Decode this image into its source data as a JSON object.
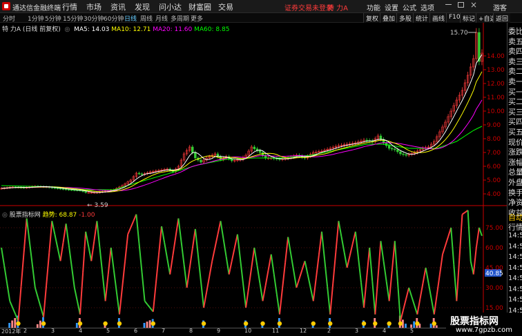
{
  "window": {
    "app_title": "通达信金融终端",
    "menu": [
      "行情",
      "市场",
      "资讯",
      "发现",
      "问小达",
      "财富圈",
      "交易"
    ],
    "login_notice": "证券交易未登录",
    "stock_name": "特 力A",
    "right_menu": [
      "功能",
      "设置",
      "公式",
      "选项"
    ],
    "guest": "游客"
  },
  "toolbar": {
    "periods": [
      "分时",
      "1分钟",
      "5分钟",
      "15分钟",
      "30分钟",
      "60分钟",
      "日线",
      "周线",
      "月线",
      "多周期",
      "更多"
    ],
    "active_period": "日线",
    "right_tools": [
      "复权",
      "叠加",
      "多股",
      "统计",
      "画线",
      "F10",
      "标记",
      "+自选",
      "返回"
    ]
  },
  "price_header": {
    "title": "特 力A (日线 前复权)",
    "ma5": "MA5: 14.03",
    "ma10": "MA10: 12.71",
    "ma20": "MA20: 11.60",
    "ma60": "MA60: 8.85"
  },
  "indicator_header": {
    "name": "股票指标网",
    "label": "趋势: ",
    "value": "68.87",
    "change": "-1.00"
  },
  "right_panel": {
    "quote_labels": [
      "委比",
      "卖五",
      "卖四",
      "卖三",
      "卖二",
      "卖一",
      "买一",
      "买二",
      "买三",
      "买四",
      "买五",
      "现价",
      "涨跌",
      "涨幅",
      "总量",
      "外盘",
      "换手",
      "净资",
      "收益"
    ],
    "auto_label": "自动",
    "quote_label": "行情",
    "times": [
      "14:5",
      "14:5",
      "14:5",
      "14:5",
      "14:5",
      "14:5",
      "14:5",
      "14:5"
    ]
  },
  "bottom_axis": {
    "year": "2012年",
    "months": [
      "2",
      "3",
      "4",
      "5",
      "6",
      "7",
      "8",
      "9",
      "10",
      "11",
      "12",
      "2",
      "3",
      "4",
      "5"
    ]
  },
  "watermark": {
    "title": "股票指标网",
    "url": "www.7gpzb.com"
  },
  "colors": {
    "up": "#ff3b3b",
    "down": "#33cc33",
    "ma5": "#ffffff",
    "ma10": "#ffff00",
    "ma20": "#ff00ff",
    "ma60": "#00ff00",
    "axis": "#cc0000"
  },
  "chart_data": [
    {
      "type": "candlestick",
      "title": "特 力A (日线 前复权)",
      "y_ticks": [
        "14.00",
        "13.00",
        "12.00",
        "11.00",
        "10.00",
        "9.00",
        "8.00",
        "7.00",
        "6.00",
        "5.00",
        "4.00"
      ],
      "y_range": [
        3.3,
        15.9
      ],
      "annotations": [
        {
          "label": "15.70",
          "value": 15.7
        },
        {
          "label": "3.59",
          "value": 3.59
        }
      ],
      "close_path": [
        [
          0,
          4.4
        ],
        [
          4,
          4.5
        ],
        [
          8,
          4.45
        ],
        [
          12,
          4.55
        ],
        [
          16,
          4.5
        ],
        [
          20,
          4.4
        ],
        [
          24,
          4.3
        ],
        [
          28,
          4.25
        ],
        [
          30,
          4.1
        ],
        [
          34,
          4.1
        ],
        [
          37,
          4.2
        ],
        [
          40,
          4.3
        ],
        [
          43,
          4.6
        ],
        [
          46,
          5.0
        ],
        [
          48,
          5.5
        ],
        [
          50,
          5.4
        ],
        [
          53,
          5.6
        ],
        [
          56,
          5.7
        ],
        [
          59,
          5.8
        ],
        [
          61,
          5.6
        ],
        [
          63,
          6.0
        ],
        [
          65,
          6.9
        ],
        [
          67,
          7.4
        ],
        [
          69,
          6.6
        ],
        [
          71,
          6.3
        ],
        [
          73,
          6.6
        ],
        [
          76,
          6.9
        ],
        [
          78,
          6.5
        ],
        [
          80,
          6.7
        ],
        [
          82,
          6.4
        ],
        [
          85,
          6.5
        ],
        [
          87,
          6.8
        ],
        [
          89,
          7.4
        ],
        [
          92,
          7.0
        ],
        [
          94,
          6.6
        ],
        [
          96,
          6.6
        ],
        [
          99,
          6.5
        ],
        [
          102,
          6.6
        ],
        [
          105,
          6.8
        ],
        [
          108,
          6.6
        ],
        [
          111,
          7.0
        ],
        [
          114,
          7.1
        ],
        [
          117,
          7.3
        ],
        [
          120,
          7.5
        ],
        [
          123,
          7.6
        ],
        [
          126,
          7.7
        ],
        [
          129,
          7.9
        ],
        [
          132,
          7.8
        ],
        [
          134,
          8.2
        ],
        [
          136,
          7.7
        ],
        [
          138,
          7.3
        ],
        [
          140,
          7.2
        ],
        [
          142,
          6.9
        ],
        [
          144,
          6.8
        ],
        [
          147,
          7.0
        ],
        [
          150,
          7.3
        ],
        [
          152,
          7.4
        ],
        [
          154,
          7.8
        ],
        [
          156,
          8.5
        ],
        [
          158,
          9.2
        ],
        [
          160,
          10.0
        ],
        [
          162,
          10.8
        ],
        [
          164,
          11.5
        ],
        [
          166,
          12.6
        ],
        [
          168,
          13.8
        ],
        [
          169,
          15.7
        ],
        [
          170,
          13.6
        ],
        [
          171,
          14.2
        ]
      ],
      "ma60_path": [
        [
          0,
          4.6
        ],
        [
          20,
          4.5
        ],
        [
          30,
          4.3
        ],
        [
          40,
          4.3
        ],
        [
          48,
          4.8
        ],
        [
          60,
          5.5
        ],
        [
          70,
          6.1
        ],
        [
          80,
          6.5
        ],
        [
          90,
          6.6
        ],
        [
          100,
          6.6
        ],
        [
          110,
          6.8
        ],
        [
          120,
          7.2
        ],
        [
          130,
          7.6
        ],
        [
          136,
          7.6
        ],
        [
          145,
          7.3
        ],
        [
          155,
          7.3
        ],
        [
          162,
          7.8
        ],
        [
          168,
          8.6
        ],
        [
          171,
          8.9
        ]
      ]
    },
    {
      "type": "line+bar",
      "title": "股票指标网",
      "series": [
        {
          "name": "趋势",
          "last_value": 68.87
        }
      ],
      "y_ticks": [
        "75.00",
        "60.00",
        "45.00",
        "30.00",
        "15.00"
      ],
      "y_range": [
        0,
        90
      ],
      "annotations": [
        {
          "label": "40.85",
          "value": 40.85
        }
      ],
      "trend_path": [
        [
          0,
          60
        ],
        [
          3,
          20
        ],
        [
          6,
          5
        ],
        [
          9,
          82
        ],
        [
          12,
          30
        ],
        [
          15,
          8
        ],
        [
          18,
          80
        ],
        [
          21,
          50
        ],
        [
          23,
          78
        ],
        [
          26,
          30
        ],
        [
          28,
          10
        ],
        [
          30,
          72
        ],
        [
          32,
          50
        ],
        [
          34,
          80
        ],
        [
          37,
          20
        ],
        [
          39,
          60
        ],
        [
          42,
          10
        ],
        [
          45,
          70
        ],
        [
          48,
          85
        ],
        [
          51,
          20
        ],
        [
          54,
          12
        ],
        [
          57,
          76
        ],
        [
          60,
          40
        ],
        [
          63,
          82
        ],
        [
          66,
          30
        ],
        [
          69,
          74
        ],
        [
          72,
          15
        ],
        [
          75,
          50
        ],
        [
          78,
          80
        ],
        [
          81,
          40
        ],
        [
          84,
          70
        ],
        [
          87,
          15
        ],
        [
          90,
          60
        ],
        [
          93,
          20
        ],
        [
          96,
          55
        ],
        [
          99,
          10
        ],
        [
          102,
          68
        ],
        [
          105,
          30
        ],
        [
          108,
          50
        ],
        [
          111,
          20
        ],
        [
          114,
          72
        ],
        [
          117,
          10
        ],
        [
          120,
          80
        ],
        [
          123,
          45
        ],
        [
          126,
          72
        ],
        [
          129,
          15
        ],
        [
          131,
          60
        ],
        [
          133,
          10
        ],
        [
          135,
          65
        ],
        [
          138,
          20
        ],
        [
          140,
          65
        ],
        [
          142,
          5
        ],
        [
          145,
          30
        ],
        [
          148,
          10
        ],
        [
          151,
          45
        ],
        [
          154,
          10
        ],
        [
          157,
          55
        ],
        [
          160,
          75
        ],
        [
          162,
          20
        ],
        [
          164,
          85
        ],
        [
          166,
          88
        ],
        [
          167,
          50
        ],
        [
          168,
          40
        ],
        [
          169,
          60
        ],
        [
          170,
          75
        ],
        [
          171,
          68.87
        ]
      ]
    }
  ]
}
